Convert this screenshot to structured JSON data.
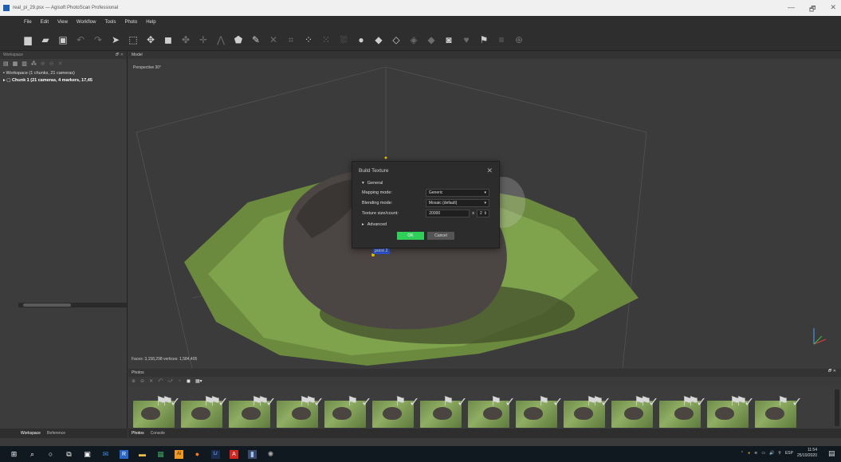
{
  "window": {
    "title": "real_pi_29.psx — Agisoft PhotoScan Professional",
    "controls": [
      "—",
      "🗗",
      "✕"
    ]
  },
  "menu": [
    "File",
    "Edit",
    "View",
    "Workflow",
    "Tools",
    "Photo",
    "Help"
  ],
  "workspace": {
    "header": "Workspace",
    "tree_root": "Workspace (1 chunks, 21 cameras)",
    "chunk": "Chunk 1 (21 cameras, 4 markers, 17,45",
    "tabs": [
      "Workspace",
      "Reference"
    ]
  },
  "model": {
    "header": "Model",
    "perspective": "Perspective 30°",
    "stats": "Faces: 3,158,298 vertices: 1,584,405",
    "point_label": "point 2"
  },
  "dialog": {
    "title": "Build Texture",
    "section_general": "General",
    "mapping_label": "Mapping mode:",
    "mapping_value": "Generic",
    "blending_label": "Blending mode:",
    "blending_value": "Mosaic (default)",
    "texture_label": "Texture size/count:",
    "texture_size": "20000",
    "texture_x": "x",
    "texture_count": "2",
    "section_advanced": "Advanced",
    "ok": "OK",
    "cancel": "Cancel"
  },
  "photos": {
    "header": "Photos",
    "count": 14,
    "flags": [
      true,
      true,
      true,
      true,
      false,
      false,
      false,
      false,
      false,
      true,
      true,
      true,
      true,
      false
    ],
    "tabs": [
      "Photos",
      "Console"
    ]
  },
  "tray": {
    "lang": "ESP",
    "time": "11:54",
    "date": "25/10/2020"
  },
  "colors": {
    "ok_green": "#2fcf5a",
    "point_blue": "#3057d6"
  }
}
